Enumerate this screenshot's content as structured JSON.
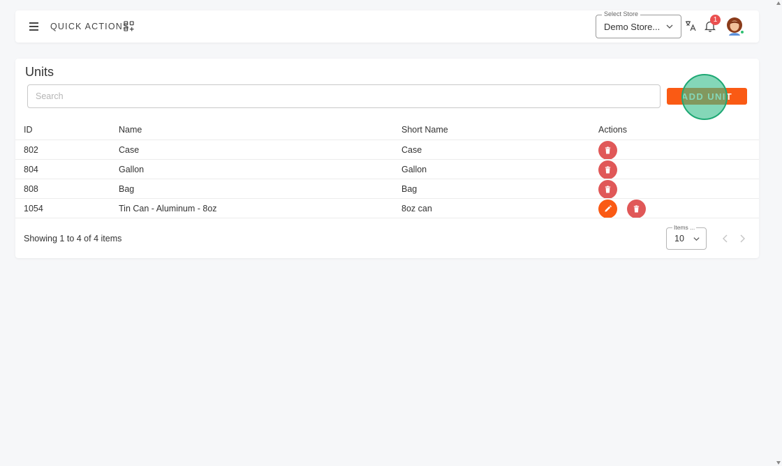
{
  "header": {
    "quick_actions_label": "QUICK ACTIONS",
    "store_select": {
      "legend": "Select Store",
      "value": "Demo Store..."
    },
    "notification_count": "1"
  },
  "units_page": {
    "title": "Units",
    "search_placeholder": "Search",
    "add_button_label": "ADD UNIT",
    "columns": [
      "ID",
      "Name",
      "Short Name",
      "Actions"
    ],
    "rows": [
      {
        "id": "802",
        "name": "Case",
        "short_name": "Case",
        "actions": [
          "delete"
        ]
      },
      {
        "id": "804",
        "name": "Gallon",
        "short_name": "Gallon",
        "actions": [
          "delete"
        ]
      },
      {
        "id": "808",
        "name": "Bag",
        "short_name": "Bag",
        "actions": [
          "delete"
        ]
      },
      {
        "id": "1054",
        "name": "Tin Can - Aluminum - 8oz",
        "short_name": "8oz can",
        "actions": [
          "edit",
          "delete"
        ]
      }
    ],
    "footer_text": "Showing 1 to 4 of 4 items",
    "items_per_page": {
      "legend": "Items ...",
      "value": "10"
    }
  },
  "colors": {
    "accent": "#fa5a14",
    "delete": "#e05858",
    "badge": "#ea4f4f",
    "click_indicator": "#1ea874"
  },
  "icons": [
    "menu-icon",
    "quick-actions-grid-icon",
    "chevron-down-icon",
    "translate-icon",
    "bell-icon",
    "avatar",
    "trash-icon",
    "pencil-icon",
    "chevron-left-icon",
    "chevron-right-icon"
  ]
}
